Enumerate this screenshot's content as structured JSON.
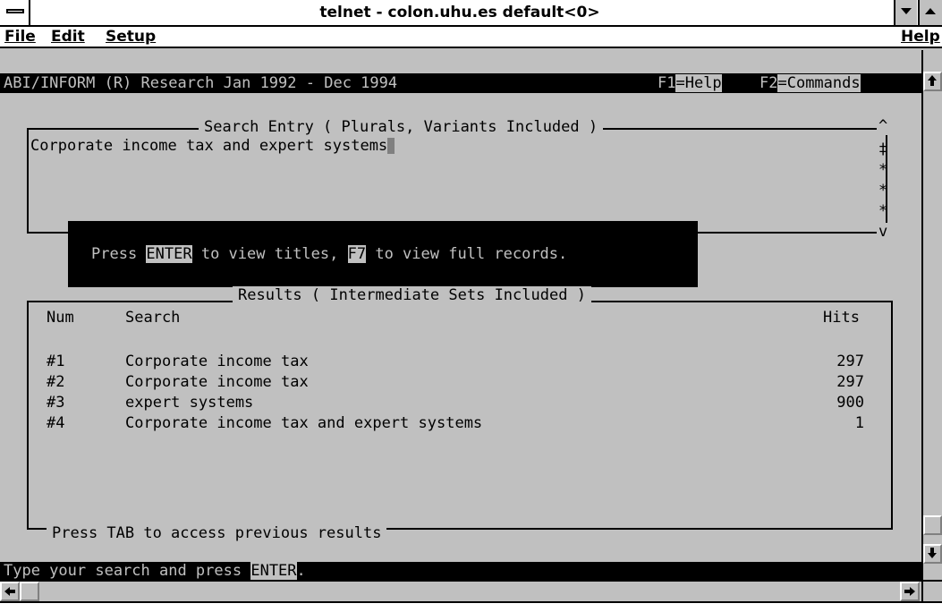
{
  "window": {
    "title": "telnet - colon.uhu.es default<0>"
  },
  "menu": {
    "file": "File",
    "edit": "Edit",
    "setup": "Setup",
    "help": "Help"
  },
  "status_top": {
    "database": "ABI/INFORM (R) Research Jan 1992 - Dec 1994",
    "f1_key": "F1",
    "f1_label": "=Help",
    "f2_key": "F2",
    "f2_label": "=Commands"
  },
  "search_entry": {
    "label": "Search Entry ( Plurals, Variants Included )",
    "value": "Corporate income tax and expert systems",
    "side_marks": [
      "^",
      "‡",
      "*",
      "*",
      "*",
      "v"
    ]
  },
  "popup": {
    "text_before": "Press ",
    "key_enter": "ENTER",
    "text_middle": " to view titles, ",
    "key_f7": "F7",
    "text_after": " to view full records."
  },
  "results": {
    "label": "Results ( Intermediate Sets Included )",
    "headers": {
      "num": "Num",
      "search": "Search",
      "hits": "Hits"
    },
    "rows": [
      {
        "num": "#1",
        "search": "Corporate income tax",
        "hits": "297"
      },
      {
        "num": "#2",
        "search": "Corporate income tax",
        "hits": "297"
      },
      {
        "num": "#3",
        "search": "expert systems",
        "hits": "900"
      },
      {
        "num": "#4",
        "search": "Corporate income tax and expert systems",
        "hits": "1"
      }
    ],
    "footer": "Press TAB to access previous results"
  },
  "status_bottom": {
    "text": "Type your search and press ",
    "key": "ENTER",
    "suffix": "."
  },
  "icons": {
    "system_menu": "system-menu-icon",
    "minimize": "minimize-icon",
    "maximize": "maximize-icon",
    "scroll_up": "arrow-up-icon",
    "scroll_down": "arrow-down-icon",
    "scroll_left": "arrow-left-icon",
    "scroll_right": "arrow-right-icon"
  }
}
